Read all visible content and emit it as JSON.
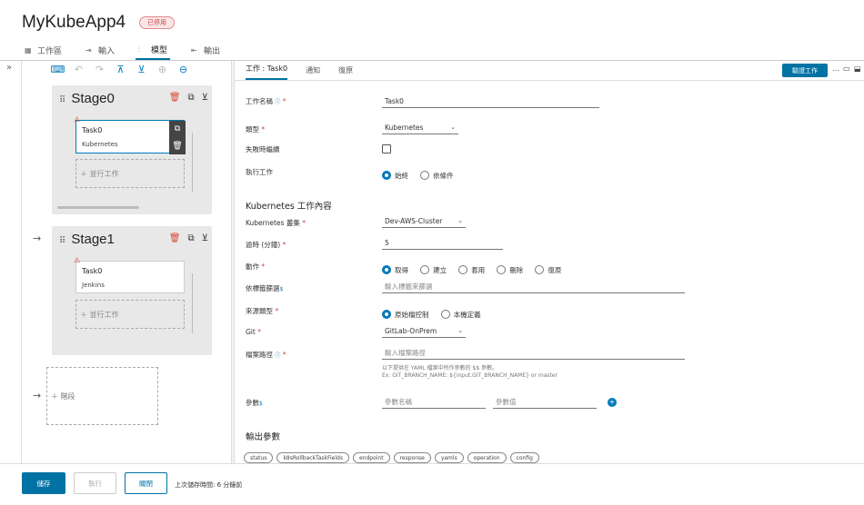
{
  "header": {
    "title": "MyKubeApp4",
    "badge": "已停用"
  },
  "tabs": [
    {
      "label": "工作區",
      "icon": "workspace-icon"
    },
    {
      "label": "輸入",
      "icon": "input-icon"
    },
    {
      "label": "模型",
      "icon": "model-icon",
      "active": true
    },
    {
      "label": "輸出",
      "icon": "output-icon"
    }
  ],
  "canvas": {
    "stages": [
      {
        "name": "Stage0",
        "task": {
          "name": "Task0",
          "type": "Kubernetes"
        },
        "parallel_label": "並行工作"
      },
      {
        "name": "Stage1",
        "task": {
          "name": "Task0",
          "type": "Jenkins"
        },
        "parallel_label": "並行工作"
      }
    ],
    "new_stage_label": "階段"
  },
  "panel": {
    "tabs": [
      "工作 : Task0",
      "通知",
      "復原"
    ],
    "validate_label": "驗證工作",
    "task_name_label": "工作名稱",
    "task_name_value": "Task0",
    "type_label": "類型",
    "type_value": "Kubernetes",
    "continue_on_failure_label": "失敗時繼續",
    "execute_task_label": "執行工作",
    "execute_options": [
      "始終",
      "依條件"
    ],
    "section_title": "Kubernetes 工作內容",
    "cluster_label": "Kubernetes 叢集",
    "cluster_value": "Dev-AWS-Cluster",
    "timeout_label": "逾時 (分鐘)",
    "timeout_value": "5",
    "action_label": "動作",
    "action_options": [
      "取得",
      "建立",
      "套用",
      "刪除",
      "復原"
    ],
    "filter_label": "依標籤篩選",
    "filter_placeholder": "輸入標籤來篩選",
    "source_label": "來源類型",
    "source_options": [
      "原始檔控制",
      "本機定義"
    ],
    "git_label": "Git",
    "git_value": "GitLab-OnPrem",
    "filepath_label": "檔案路徑",
    "filepath_placeholder": "輸入檔案路徑",
    "hint_line1": "以下提供在 YAML 檔案中所作參數的 $$ 參數。",
    "hint_line2": "Ex: GIT_BRANCH_NAME: ${input.GIT_BRANCH_NAME} or master",
    "params_label": "參數",
    "param_name_placeholder": "參數名稱",
    "param_value_placeholder": "參數值",
    "output_title": "輸出參數",
    "output_params": [
      "status",
      "k8sRollbackTaskFields",
      "endpoint",
      "response",
      "yamls",
      "operation",
      "config"
    ]
  },
  "footer": {
    "save": "儲存",
    "run": "執行",
    "close": "關閉",
    "last_saved": "上次儲存時間: 6 分鐘前"
  }
}
